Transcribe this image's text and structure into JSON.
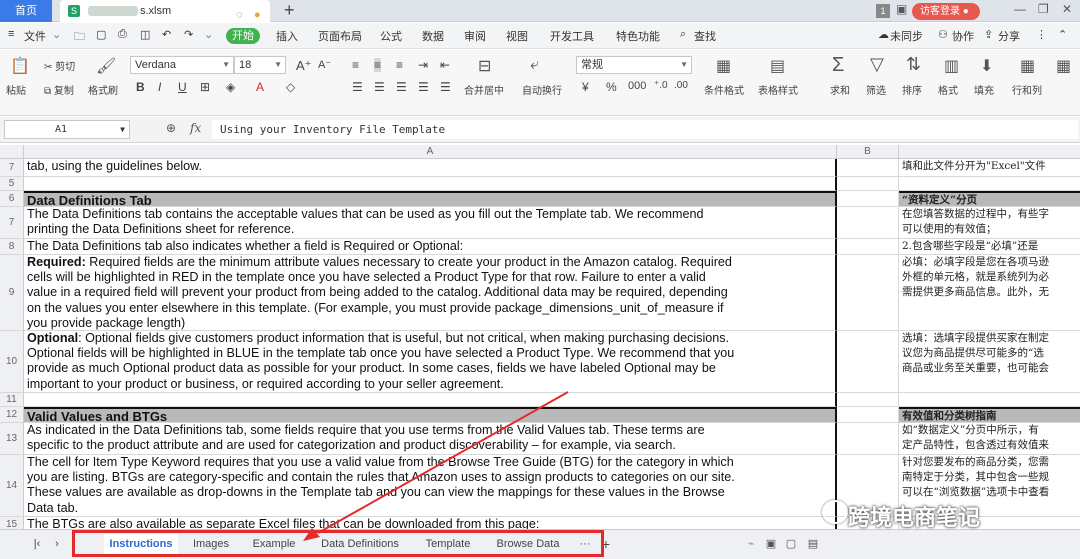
{
  "titlebar": {
    "home_tab": "首页",
    "file_tab": "s.xlsm",
    "new_tab": "+",
    "badge": "1",
    "login": "访客登录"
  },
  "menu": {
    "file": "文件",
    "start": "开始",
    "items": [
      "插入",
      "页面布局",
      "公式",
      "数据",
      "审阅",
      "视图",
      "开发工具",
      "特色功能"
    ],
    "search": "查找",
    "sync": "未同步",
    "collab": "协作",
    "share": "分享"
  },
  "ribbon": {
    "paste": "粘贴",
    "cut": "剪切",
    "copy": "复制",
    "format_painter": "格式刷",
    "font_name": "Verdana",
    "font_size": "18",
    "merge": "合并居中",
    "wrap": "自动换行",
    "number_format": "常规",
    "conditional": "条件格式",
    "table_style": "表格样式",
    "sum": "求和",
    "filter": "筛选",
    "sort": "排序",
    "format": "格式",
    "fill": "填充",
    "rowcol": "行和列"
  },
  "formula": {
    "cell_ref": "A1",
    "fx": "fx",
    "content": "Using your Inventory File Template"
  },
  "columns": [
    "A",
    "B"
  ],
  "rows": [
    {
      "num": "7",
      "a": "tab, using the guidelines below.",
      "c": [
        "填和此文件分开为\"Excel\"文件"
      ],
      "hdr": false,
      "h": 18
    },
    {
      "num": "5",
      "a": "",
      "c": [
        ""
      ],
      "hdr": false,
      "h": 14
    },
    {
      "num": "6",
      "a": "Data Definitions Tab",
      "c": [
        "“资料定义”分页"
      ],
      "hdr": true,
      "h": 16
    },
    {
      "num": "7",
      "a": "The Data Definitions tab contains the acceptable values that can be used as you fill out the Template tab. We recommend\nprinting the Data Definitions sheet for reference.",
      "c": [
        "在您填答数据的过程中，有些字",
        "可以使用的有效值；"
      ],
      "hdr": false,
      "h": 32
    },
    {
      "num": "8",
      "a": "The Data Definitions tab also indicates whether a field is Required or Optional:",
      "c": [
        "2.包含哪些字段是“必填”还是"
      ],
      "hdr": false,
      "h": 16
    },
    {
      "num": "9",
      "a": "REQ",
      "c": [
        "",
        "必填：必填字段是您在各项马逊",
        "外框的单元格，就是系统列为必",
        "需提供更多商品信息。此外，无"
      ],
      "hdr": false,
      "h": 76
    },
    {
      "num": "10",
      "a": "OPT",
      "c": [
        "",
        "选填：选填字段提供买家在制定",
        "议您为商品提供尽可能多的“选",
        "商品或业务至关重要，也可能会"
      ],
      "hdr": false,
      "h": 62
    },
    {
      "num": "11",
      "a": "",
      "c": [
        ""
      ],
      "hdr": false,
      "h": 14
    },
    {
      "num": "12",
      "a": "Valid Values and BTGs",
      "c": [
        "有效值和分类树指南"
      ],
      "hdr": true,
      "h": 16
    },
    {
      "num": "13",
      "a": "As indicated in the Data Definitions tab, some fields require that you use terms from the Valid Values tab. These terms are\nspecific to the product attribute and are used for categorization and product discoverability – for example, via search.",
      "c": [
        "如“数据定义”分页中所示，有",
        "定产品特性，包含透过有效值来"
      ],
      "hdr": false,
      "h": 32
    },
    {
      "num": "14",
      "a": "The cell for Item Type Keyword requires that you use a valid value from the Browse Tree Guide (BTG) for the category in which\nyou are listing. BTGs are category-specific and contain the rules that Amazon uses to assign products to categories on our site.\nThese values are available as drop-downs in the Template tab and you can view the mappings for these values in the Browse\nData tab.",
      "c": [
        "针对您要发布的商品分类，您需",
        "南特定于分类，其中包含一些规",
        "可以在“浏览数据”选项卡中查看"
      ],
      "hdr": false,
      "h": 62
    },
    {
      "num": "15",
      "a": "The BTGs are also available as separate Excel files that can be downloaded from this page:",
      "c": [
        ""
      ],
      "hdr": false,
      "h": 16
    }
  ],
  "rich": {
    "required_label": "Required:",
    "required_text": " Required fields are the minimum attribute values necessary to create your product in the Amazon catalog. Required\ncells will be highlighted in RED in the template once you have selected a Product Type for that row. Failure to enter a valid\nvalue in a required field will prevent your product from being added to the catalog. Additional data may be required, depending\non the values you enter elsewhere in this template. (For example, you must provide package_dimensions_unit_of_measure if\nyou provide package length)",
    "optional_label": "Optional",
    "optional_text": ": Optional fields give customers product information that is useful, but not critical, when making purchasing decisions.\nOptional fields will be highlighted in BLUE in the template tab once you have selected a Product Type. We recommend that you\nprovide as much Optional product data as possible for your product. In some cases, fields we have labeled Optional may be\nimportant to your product or business, or required according to your seller agreement."
  },
  "sheet_tabs": [
    "Instructions",
    "Images",
    "Example",
    "Data Definitions",
    "Template",
    "Browse Data"
  ],
  "sheet_more": "···",
  "sheet_add": "+",
  "watermark": "跨境电商笔记",
  "colors": {
    "accent": "#3b7be8",
    "highlight": "#e32b2b",
    "start": "#41b34e"
  }
}
